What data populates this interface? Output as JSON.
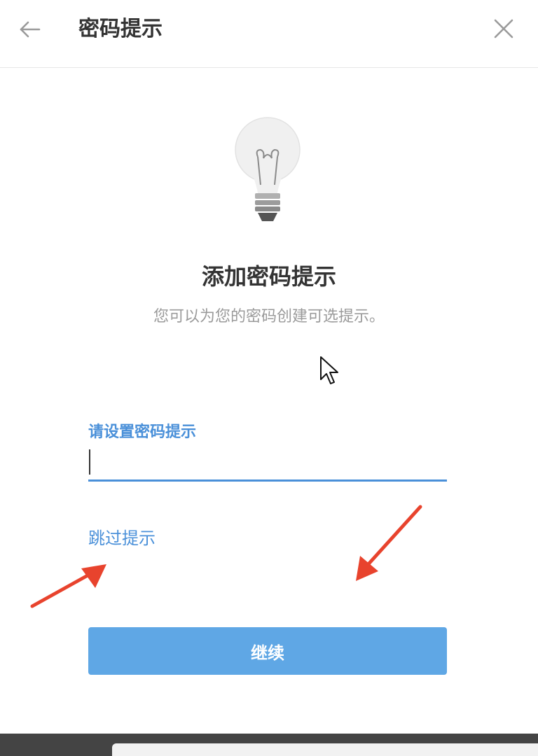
{
  "header": {
    "title": "密码提示",
    "back_icon": "arrow-left-icon",
    "close_icon": "close-icon"
  },
  "main": {
    "illustration_icon": "lightbulb-icon",
    "heading": "添加密码提示",
    "subtitle": "您可以为您的密码创建可选提示。",
    "field_label": "请设置密码提示",
    "input_value": "",
    "skip_label": "跳过提示",
    "continue_label": "继续"
  },
  "colors": {
    "accent": "#4a90d9",
    "button_bg": "#5fa7e5",
    "annotation_arrow": "#e8432d",
    "text_primary": "#333333",
    "text_secondary": "#9a9a9a"
  }
}
